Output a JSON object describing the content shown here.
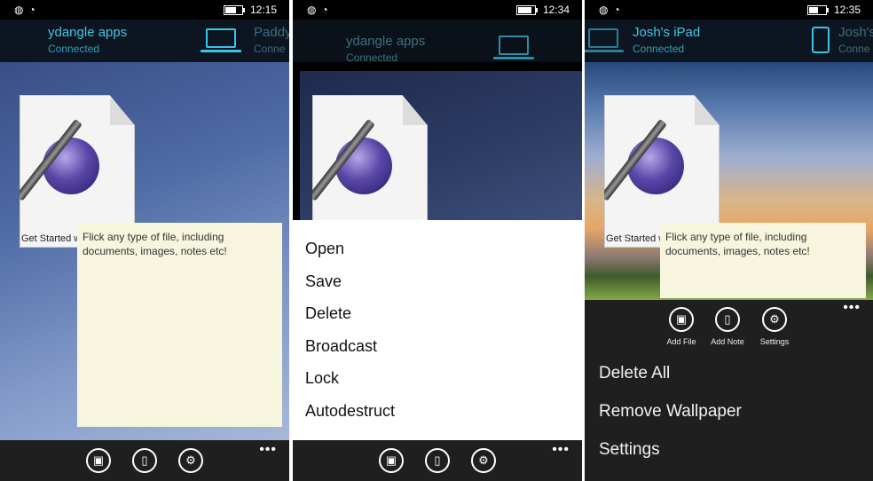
{
  "panel1": {
    "status_time": "12:15",
    "devices": [
      {
        "name": "ydangle apps",
        "status": "Connected"
      },
      {
        "name": "Paddy",
        "status": "Conne"
      }
    ],
    "file_label": "Get Started w",
    "note_text": "Flick any type of file, including documents, images, notes etc!"
  },
  "panel2": {
    "status_time": "12:34",
    "devices": [
      {
        "name": "ydangle apps",
        "status": "Connected"
      }
    ],
    "menu": [
      "Open",
      "Save",
      "Delete",
      "Broadcast",
      "Lock",
      "Autodestruct"
    ]
  },
  "panel3": {
    "status_time": "12:35",
    "devices": [
      {
        "name": "Josh's iPad",
        "status": "Connected"
      },
      {
        "name": "Josh's",
        "status": "Conne"
      }
    ],
    "file_label": "Get Started w",
    "note_text": "Flick any type of file, including documents, images, notes etc!",
    "appbar_buttons": [
      "Add File",
      "Add Note",
      "Settings"
    ],
    "menu": [
      "Delete All",
      "Remove Wallpaper",
      "Settings"
    ]
  },
  "appbar": {
    "ellipsis": "•••",
    "icons": [
      "add-file-icon",
      "add-note-icon",
      "settings-icon"
    ]
  },
  "colors": {
    "accent": "#39c5e4",
    "note": "#f7f5de",
    "appbar": "#1f1f1f"
  }
}
